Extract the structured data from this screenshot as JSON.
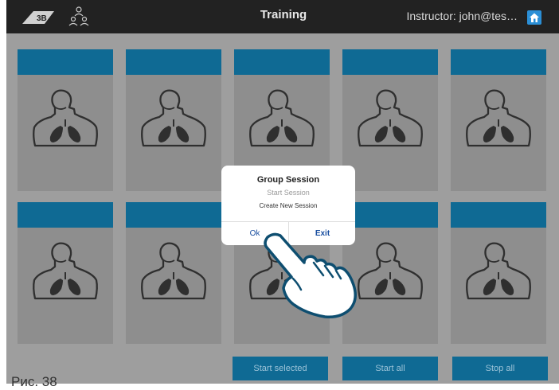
{
  "header": {
    "title": "Training",
    "instructor_label": "Instructor: john@tes…",
    "logo_icon": "3b-logo-icon",
    "group_icon": "group-users-icon",
    "home_icon": "home-icon"
  },
  "cards": {
    "icon": "torso-lungs-icon",
    "row1": [
      "",
      "",
      "",
      "",
      ""
    ],
    "row2": [
      "",
      "",
      "",
      "",
      ""
    ]
  },
  "actions": {
    "start_selected": "Start selected",
    "start_all": "Start all",
    "stop_all": "Stop all"
  },
  "dialog": {
    "title": "Group Session",
    "subtitle": "Start Session",
    "message": "Create New Session",
    "ok": "Ok",
    "exit": "Exit"
  },
  "figure_caption": "Рис. 38",
  "colors": {
    "header_bg": "#222222",
    "card_band": "#0f6a94",
    "card_bg": "#8e8e8e",
    "overlay_bg": "#9e9e9e",
    "home_button": "#2b8fd6",
    "dialog_link": "#1a4fa0"
  }
}
